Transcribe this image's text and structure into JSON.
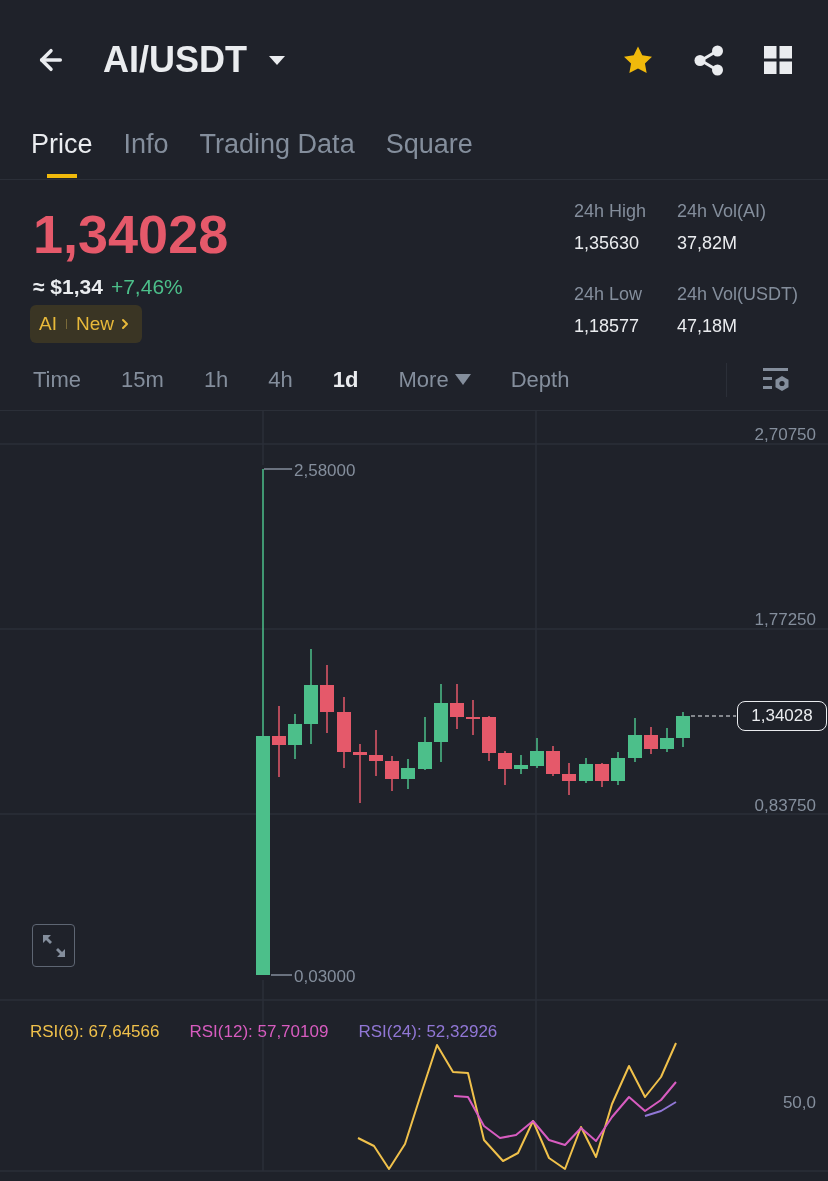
{
  "header": {
    "title": "AI/USDT"
  },
  "tabs": [
    {
      "label": "Price",
      "selected": true
    },
    {
      "label": "Info",
      "selected": false
    },
    {
      "label": "Trading Data",
      "selected": false
    },
    {
      "label": "Square",
      "selected": false
    }
  ],
  "ticker": {
    "price": "1,34028",
    "approx": "≈ $1,34",
    "change": "+7,46%",
    "tag": {
      "sector": "AI",
      "label": "New"
    }
  },
  "stats": [
    {
      "label": "24h High",
      "value": "1,35630"
    },
    {
      "label": "24h Vol(AI)",
      "value": "37,82M"
    },
    {
      "label": "24h Low",
      "value": "1,18577"
    },
    {
      "label": "24h Vol(USDT)",
      "value": "47,18M"
    }
  ],
  "intervals": [
    {
      "label": "Time",
      "kind": "plain",
      "selected": false
    },
    {
      "label": "15m",
      "kind": "plain",
      "selected": false
    },
    {
      "label": "1h",
      "kind": "plain",
      "selected": false
    },
    {
      "label": "4h",
      "kind": "plain",
      "selected": false
    },
    {
      "label": "1d",
      "kind": "plain",
      "selected": true
    },
    {
      "label": "More",
      "kind": "menu",
      "selected": false
    },
    {
      "label": "Depth",
      "kind": "plain",
      "selected": false
    }
  ],
  "chart": {
    "price_axis": [
      "2,70750",
      "1,77250",
      "0,83750"
    ],
    "high_label": "2,58000",
    "low_label": "0,03000",
    "last_price": "1,34028"
  },
  "rsi": {
    "indicators": [
      {
        "label": "RSI(6): 67,64566",
        "color": "#f0c14b"
      },
      {
        "label": "RSI(12): 57,70109",
        "color": "#d85cc0"
      },
      {
        "label": "RSI(24): 52,32926",
        "color": "#9177d6"
      }
    ],
    "axis_label": "50,0"
  }
}
